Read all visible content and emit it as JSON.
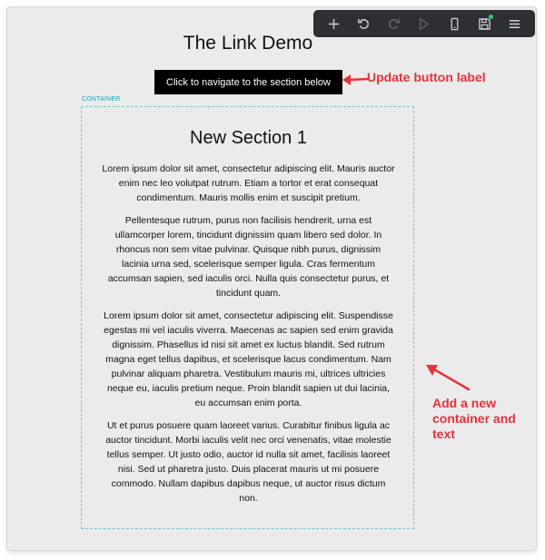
{
  "toolbar": {
    "buttons": [
      {
        "name": "add-icon"
      },
      {
        "name": "undo-icon"
      },
      {
        "name": "redo-icon"
      },
      {
        "name": "play-icon"
      },
      {
        "name": "mobile-icon"
      },
      {
        "name": "save-icon"
      },
      {
        "name": "menu-icon"
      }
    ],
    "save_dot_color": "#2ecc71"
  },
  "page": {
    "title": "The Link Demo",
    "nav_button_label": "Click to navigate to the section below",
    "container_label": "CONTAINER"
  },
  "section": {
    "heading": "New Section 1",
    "paragraphs": [
      "Lorem ipsum dolor sit amet, consectetur adipiscing elit. Mauris auctor enim nec leo volutpat rutrum. Etiam a tortor et erat consequat condimentum. Mauris mollis enim et suscipit pretium.",
      "Pellentesque rutrum, purus non facilisis hendrerit, urna est ullamcorper lorem, tincidunt dignissim quam libero sed dolor. In rhoncus non sem vitae pulvinar. Quisque nibh purus, dignissim lacinia urna sed, scelerisque semper ligula. Cras fermentum accumsan sapien, sed iaculis orci. Nulla quis consectetur purus, et tincidunt quam.",
      "Lorem ipsum dolor sit amet, consectetur adipiscing elit. Suspendisse egestas mi vel iaculis viverra. Maecenas ac sapien sed enim gravida dignissim. Phasellus id nisi sit amet ex luctus blandit. Sed rutrum magna eget tellus dapibus, et scelerisque lacus condimentum. Nam pulvinar aliquam pharetra. Vestibulum mauris mi, ultrices ultricies neque eu, iaculis pretium neque. Proin blandit sapien ut dui lacinia, eu accumsan enim porta.",
      "Ut et purus posuere quam laoreet varius. Curabitur finibus ligula ac auctor tincidunt. Morbi iaculis velit nec orci venenatis, vitae molestie tellus semper. Ut justo odio, auctor id nulla sit amet, facilisis laoreet nisi. Sed ut pharetra justo. Duis placerat mauris ut mi posuere commodo. Nullam dapibus dapibus neque, ut auctor risus dictum non."
    ]
  },
  "annotations": {
    "update_label": "Update button label",
    "add_container_lines": [
      "Add a new",
      "container and",
      "text"
    ],
    "color": "#e8313b"
  }
}
